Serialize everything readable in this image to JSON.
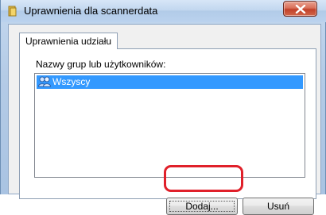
{
  "window": {
    "title": "Uprawnienia dla scannerdata"
  },
  "tabs": [
    {
      "label": "Uprawnienia udziału"
    }
  ],
  "permissions": {
    "group_label": "Nazwy grup lub użytkowników:",
    "entries": [
      {
        "name": "Wszyscy",
        "icon": "users-group-icon",
        "selected": true
      }
    ],
    "add_button": "Dodaj...",
    "remove_button": "Usuń"
  },
  "colors": {
    "selection": "#3399ff",
    "highlight": "#e0202a",
    "close": "#c2412a"
  }
}
